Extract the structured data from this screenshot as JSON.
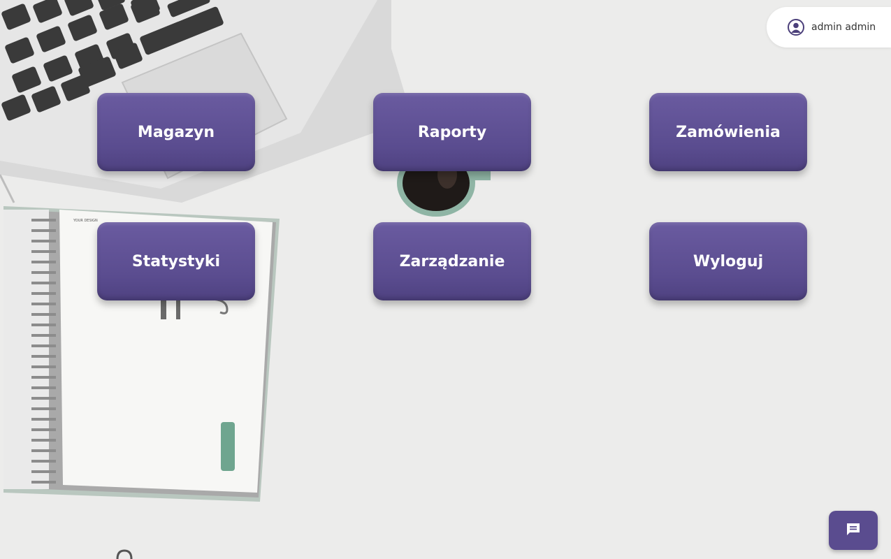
{
  "user": {
    "name": "admin admin",
    "avatar_icon": "user-circle-icon"
  },
  "menu": {
    "tiles": [
      {
        "label": "Magazyn"
      },
      {
        "label": "Raporty"
      },
      {
        "label": "Zamówienia"
      },
      {
        "label": "Statystyki"
      },
      {
        "label": "Zarządzanie"
      },
      {
        "label": "Wyloguj"
      }
    ]
  },
  "chat": {
    "icon": "chat-message-icon"
  },
  "colors": {
    "accent": "#5a4c8f",
    "background": "#ececeb"
  },
  "scene": {
    "notebook_label": "YOUR DESIGN"
  }
}
